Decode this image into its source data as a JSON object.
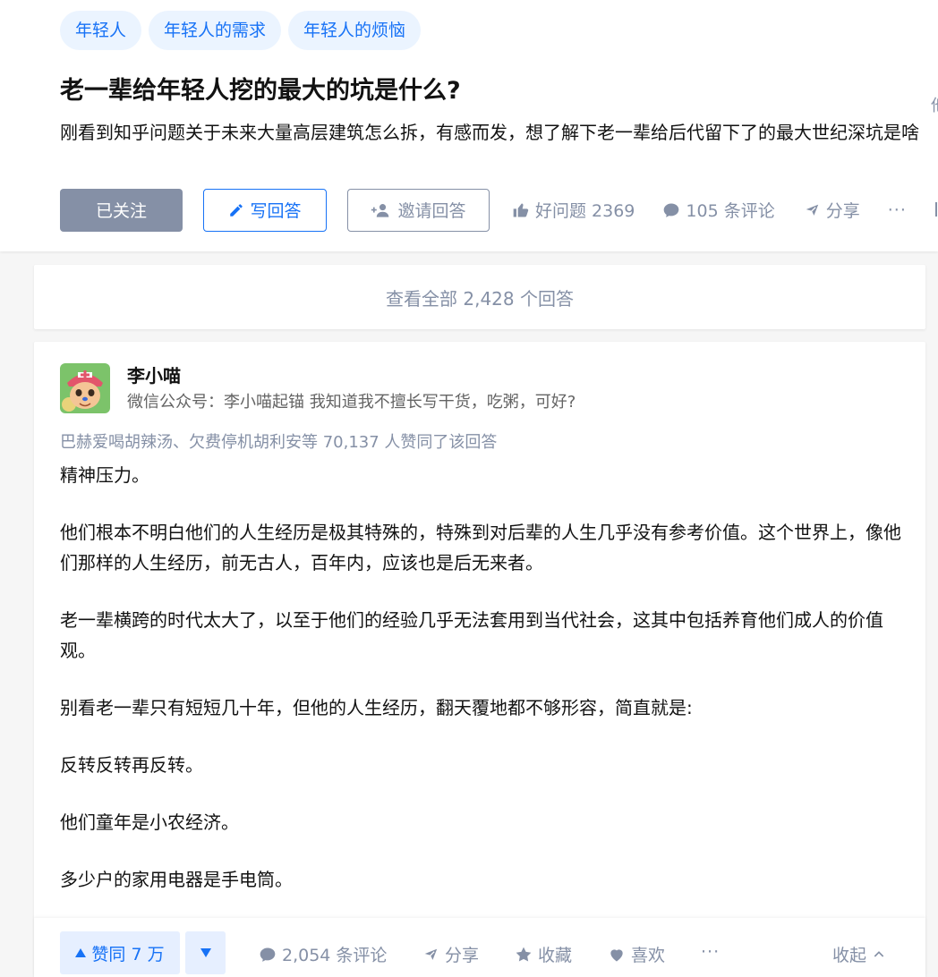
{
  "topics": [
    "年轻人",
    "年轻人的需求",
    "年轻人的烦恼"
  ],
  "question": {
    "title": "老一辈给年轻人挖的最大的坑是什么?",
    "detail": "刚看到知乎问题关于未来大量高层建筑怎么拆，有感而发，想了解下老一辈给后代留下了的最大世纪深坑是啥",
    "edge_char": "他",
    "actions": {
      "followed_label": "已关注",
      "write_label": "写回答",
      "invite_label": "邀请回答",
      "good_question_label": "好问题 2369",
      "comments_label": "105 条评论",
      "share_label": "分享",
      "more_label": "···"
    }
  },
  "view_all_label": "查看全部 2,428 个回答",
  "answer": {
    "author": {
      "name": "李小喵",
      "bio": "微信公众号：李小喵起锚 我知道我不擅长写干货，吃粥，可好?"
    },
    "voters_text": "巴赫爱喝胡辣汤、欠费停机胡利安等 70,137 人赞同了该回答",
    "paragraphs": [
      "精神压力。",
      "他们根本不明白他们的人生经历是极其特殊的，特殊到对后辈的人生几乎没有参考价值。这个世界上，像他们那样的人生经历，前无古人，百年内，应该也是后无来者。",
      "老一辈横跨的时代太大了，以至于他们的经验几乎无法套用到当代社会，这其中包括养育他们成人的价值观。",
      "别看老一辈只有短短几十年，但他的人生经历，翻天覆地都不够形容，简直就是:",
      "反转反转再反转。",
      "他们童年是小农经济。",
      "多少户的家用电器是手电筒。"
    ],
    "actions": {
      "vote_up_label": "赞同 7 万",
      "comments_label": "2,054 条评论",
      "share_label": "分享",
      "collect_label": "收藏",
      "like_label": "喜欢",
      "more_label": "···",
      "collapse_label": "收起"
    }
  },
  "colors": {
    "brand_blue": "#1772f6",
    "tag_bg": "#ebf4ff",
    "muted_gray": "#8590a6",
    "page_bg": "#f6f6f6"
  }
}
